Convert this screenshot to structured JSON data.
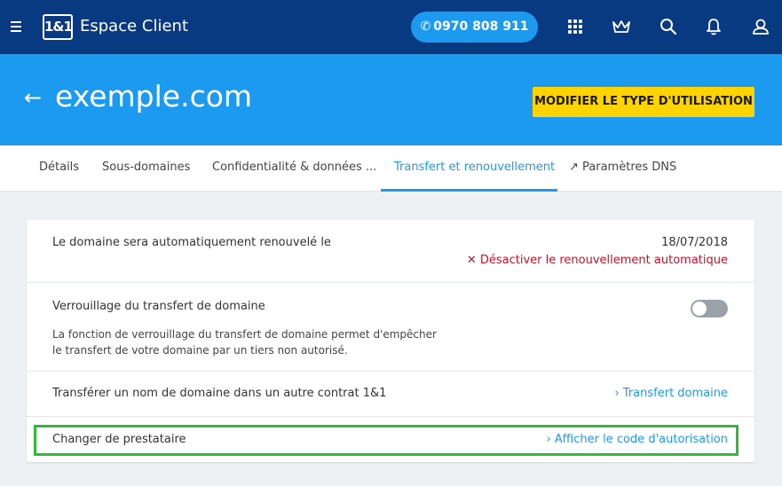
{
  "header": {
    "app_title": "Espace Client",
    "logo_text": "1&1",
    "phone": "0970 808 911",
    "icons": [
      "menu-icon",
      "grid-icon",
      "crown-icon",
      "search-icon",
      "bell-icon",
      "user-icon"
    ]
  },
  "hero": {
    "domain": "exemple.com",
    "modify_button": "MODIFIER LE TYPE D'UTILISATION"
  },
  "tabs": [
    {
      "label": "Détails"
    },
    {
      "label": "Sous-domaines"
    },
    {
      "label": "Confidentialité & données ..."
    },
    {
      "label": "Transfert et renouvellement",
      "active": true
    },
    {
      "label": "↗ Paramètres DNS"
    }
  ],
  "card": {
    "renewal": {
      "label": "Le domaine sera automatiquement renouvelé le",
      "date": "18/07/2018",
      "deactivate_link": "✕ Désactiver le renouvellement automatique"
    },
    "lock": {
      "label": "Verrouillage du transfert de domaine",
      "description": "La fonction de verrouillage du transfert de domaine permet d'empêcher le transfert de votre domaine par un tiers non autorisé.",
      "toggle_on": false
    },
    "transfer": {
      "label": "Transférer un nom de domaine dans un autre contrat 1&1",
      "link": "› Transfert domaine"
    },
    "provider": {
      "label": "Changer de prestataire",
      "link": "› Afficher le code d'autorisation"
    }
  },
  "colors": {
    "topbar": "#083a81",
    "accent_blue": "#1c9aef",
    "yellow_button": "#ffd400",
    "highlight_green": "#2ebd35",
    "danger_red": "#c8102e"
  }
}
